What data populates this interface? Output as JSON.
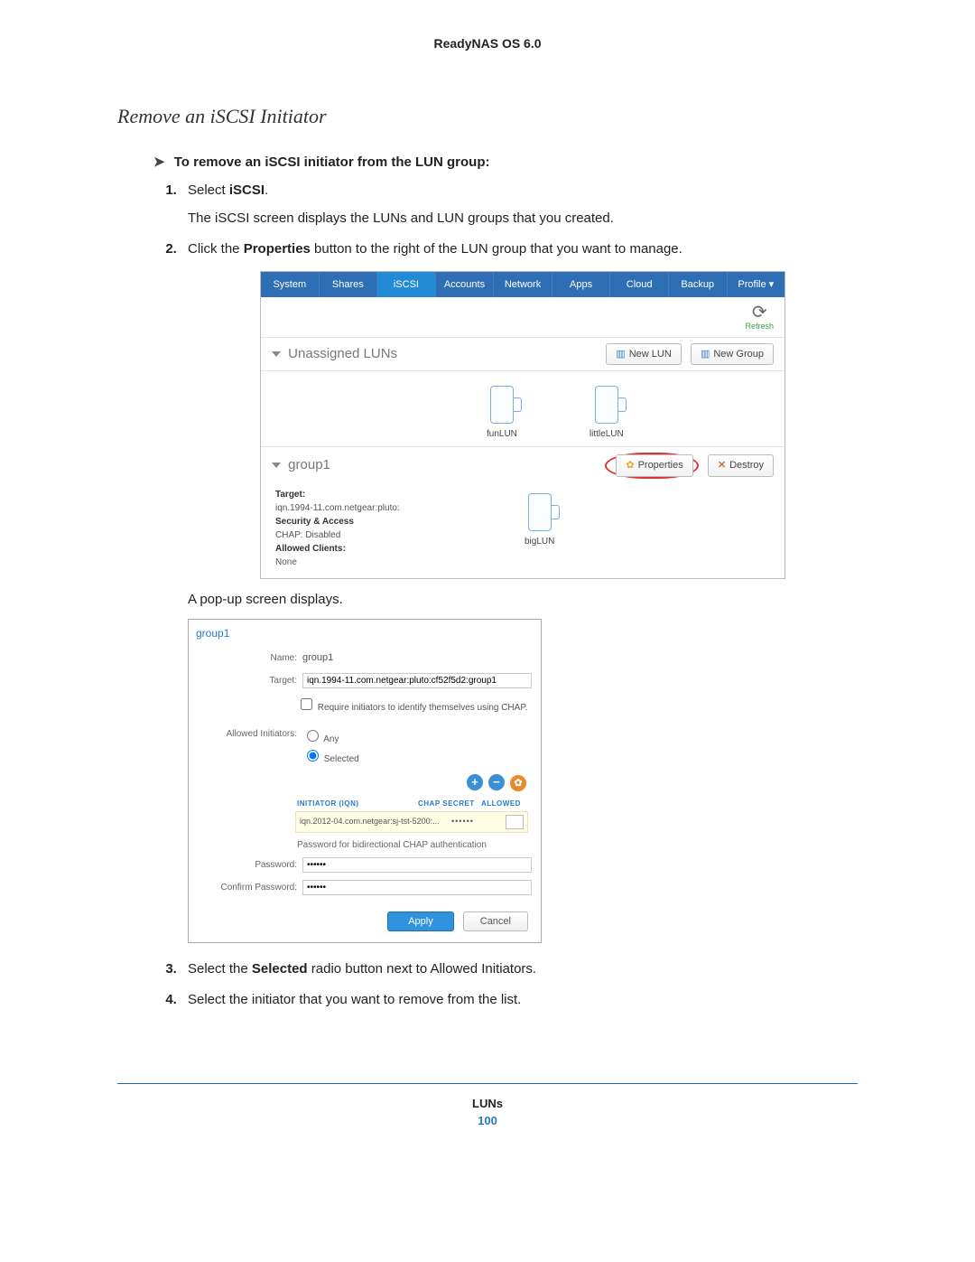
{
  "header": {
    "title": "ReadyNAS OS 6.0"
  },
  "section_title": "Remove an iSCSI Initiator",
  "lead": {
    "arrow": "➤",
    "text": "To remove an iSCSI initiator from the LUN group:"
  },
  "steps": {
    "s1": {
      "prefix": "Select ",
      "bold": "iSCSI",
      "suffix": ".",
      "sub": "The iSCSI screen displays the LUNs and LUN groups that you created."
    },
    "s2": {
      "prefix": "Click the ",
      "bold": "Properties",
      "suffix": " button to the right of the LUN group that you want to manage."
    },
    "s2_sub": "A pop-up screen displays.",
    "s3": {
      "prefix": "Select the ",
      "bold": "Selected",
      "suffix": " radio button next to Allowed Initiators."
    },
    "s4": {
      "full": "Select the initiator that you want to remove from the list."
    }
  },
  "iscsi_screen": {
    "tabs": [
      "System",
      "Shares",
      "iSCSI",
      "Accounts",
      "Network",
      "Apps",
      "Cloud",
      "Backup",
      "Profile ▾"
    ],
    "active_tab_index": 2,
    "refresh": "Refresh",
    "unassigned_title": "Unassigned LUNs",
    "btn_new_lun": "New LUN",
    "btn_new_group": "New Group",
    "luns": [
      "funLUN",
      "littleLUN"
    ],
    "group": {
      "name": "group1",
      "btn_properties": "Properties",
      "btn_destroy": "Destroy",
      "target_label": "Target:",
      "target_value": "iqn.1994-11.com.netgear:pluto:",
      "sec_label": "Security & Access",
      "sec_value": "CHAP: Disabled",
      "allowed_label": "Allowed Clients:",
      "allowed_value": "None",
      "lun": "bigLUN"
    }
  },
  "popup": {
    "title": "group1",
    "name_label": "Name:",
    "name_value": "group1",
    "target_label": "Target:",
    "target_value": "iqn.1994-11.com.netgear:pluto:cf52f5d2:group1",
    "chap_cb": "Require initiators to identify themselves using CHAP.",
    "allowed_label": "Allowed Initiators:",
    "radio_any": "Any",
    "radio_selected": "Selected",
    "th_iqn": "INITIATOR (IQN)",
    "th_secret": "CHAP SECRET",
    "th_allowed": "ALLOWED",
    "init_iqn": "iqn.2012-04.com.netgear:sj-tst-5200:...",
    "init_secret": "••••••",
    "bidir_label": "Password for bidirectional CHAP authentication",
    "pw_label": "Password:",
    "pw_value": "••••••",
    "cpw_label": "Confirm Password:",
    "cpw_value": "••••••",
    "apply": "Apply",
    "cancel": "Cancel"
  },
  "footer": {
    "title": "LUNs",
    "page": "100"
  }
}
